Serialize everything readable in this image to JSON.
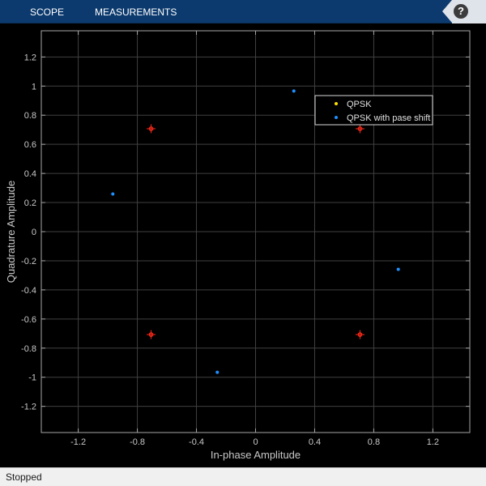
{
  "toolstrip": {
    "tabs": [
      {
        "label": "SCOPE"
      },
      {
        "label": "MEASUREMENTS"
      }
    ],
    "help_label": "?"
  },
  "status": {
    "text": "Stopped"
  },
  "colors": {
    "toolstrip": "#0c3a6e",
    "plot_background": "#000000",
    "grid": "#404040",
    "axis_text": "#c8c8c8",
    "qpsk": "#ffe000",
    "qpsk_phase_shift": "#1e90ff",
    "reference_constellation": "#ff2a1a"
  },
  "chart_data": {
    "type": "scatter",
    "xlabel": "In-phase Amplitude",
    "ylabel": "Quadrature Amplitude",
    "xlim": [
      -1.45,
      1.45
    ],
    "ylim": [
      -1.38,
      1.38
    ],
    "grid": true,
    "xticks": [
      -1.2,
      -0.8,
      -0.4,
      0,
      0.4,
      0.8,
      1.2
    ],
    "xtick_labels": [
      "-1.2",
      "-0.8",
      "-0.4",
      "0",
      "0.4",
      "0.8",
      "1.2"
    ],
    "yticks": [
      -1.2,
      -1,
      -0.8,
      -0.6,
      -0.4,
      -0.2,
      0,
      0.2,
      0.4,
      0.6,
      0.8,
      1,
      1.2
    ],
    "ytick_labels": [
      "-1.2",
      "-1",
      "-0.8",
      "-0.6",
      "-0.4",
      "-0.2",
      "0",
      "0.2",
      "0.4",
      "0.6",
      "0.8",
      "1",
      "1.2"
    ],
    "legend_position": "top-right",
    "series": [
      {
        "name": "QPSK",
        "color": "#ffe000",
        "points": []
      },
      {
        "name": "QPSK with pase shift",
        "color": "#1e90ff",
        "points": [
          {
            "x": 0.259,
            "y": 0.966
          },
          {
            "x": -0.966,
            "y": 0.259
          },
          {
            "x": -0.259,
            "y": -0.966
          },
          {
            "x": 0.966,
            "y": -0.259
          }
        ]
      }
    ],
    "reference_points": [
      {
        "x": -0.707,
        "y": 0.707
      },
      {
        "x": 0.707,
        "y": 0.707
      },
      {
        "x": -0.707,
        "y": -0.707
      },
      {
        "x": 0.707,
        "y": -0.707
      }
    ]
  }
}
